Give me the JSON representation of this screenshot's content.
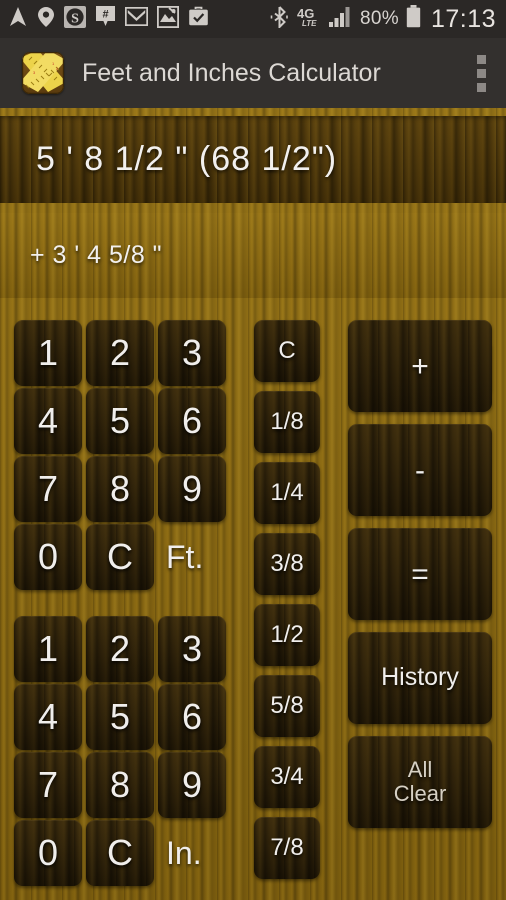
{
  "statusbar": {
    "icons": [
      {
        "name": "navigation-icon",
        "label": "navigation"
      },
      {
        "name": "location-pin-icon",
        "label": "location"
      },
      {
        "name": "skype-icon",
        "label": "S"
      },
      {
        "name": "slack-hash-icon",
        "label": "#"
      },
      {
        "name": "gmail-icon",
        "label": "M"
      },
      {
        "name": "broken-image-icon",
        "label": "image"
      },
      {
        "name": "briefcase-check-icon",
        "label": "work"
      }
    ],
    "bluetooth": "bluetooth-icon",
    "network_label": "4G",
    "network_sub": "LTE",
    "signal": "signal-bars-icon",
    "battery_percent": "80%",
    "battery": "battery-icon",
    "clock": "17:13"
  },
  "actionbar": {
    "app_icon": "tape-measure-icon",
    "title": "Feet and Inches Calculator",
    "overflow": "overflow-menu-icon"
  },
  "display": {
    "result": "5 '  8 1/2 \"   (68 1/2\")",
    "entry": "+ 3 ' 4 5/8 \"",
    "clear_label": "Clear"
  },
  "feet_pad": {
    "unit_label": "Ft.",
    "keys": [
      "1",
      "2",
      "3",
      "4",
      "5",
      "6",
      "7",
      "8",
      "9",
      "0",
      "C"
    ]
  },
  "inches_pad": {
    "unit_label": "In.",
    "keys": [
      "1",
      "2",
      "3",
      "4",
      "5",
      "6",
      "7",
      "8",
      "9",
      "0",
      "C"
    ]
  },
  "fractions": {
    "keys": [
      "C",
      "1/8",
      "1/4",
      "3/8",
      "1/2",
      "5/8",
      "3/4",
      "7/8"
    ]
  },
  "operations": {
    "keys": [
      {
        "name": "plus-button",
        "label": "+"
      },
      {
        "name": "minus-button",
        "label": "-"
      },
      {
        "name": "equals-button",
        "label": "="
      },
      {
        "name": "history-button",
        "label": "History"
      },
      {
        "name": "all-clear-button",
        "label": "All\nClear"
      }
    ]
  },
  "colors": {
    "wood_light": "#8a6810",
    "wood_dark": "#51390a",
    "key_face": "#2a1e08",
    "text": "#f0eeec",
    "statusbar": "#2b2826",
    "actionbar": "#33302e"
  }
}
